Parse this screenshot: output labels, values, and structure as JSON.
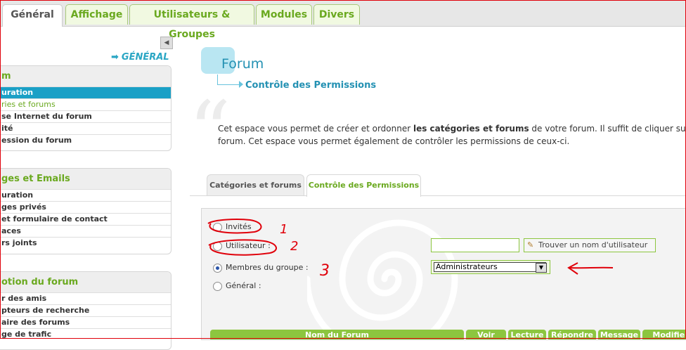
{
  "top_tabs": [
    "Général",
    "Affichage",
    "Utilisateurs & Groupes",
    "Modules",
    "Divers"
  ],
  "sidebar": {
    "section_heading": "GÉNÉRAL",
    "boxes": [
      {
        "title": "m",
        "items": [
          "uration",
          "ries et forums",
          "se Internet du forum",
          "ité",
          "ession du forum"
        ]
      },
      {
        "title": "ges et Emails",
        "items": [
          "uration",
          "ges privés",
          "et formulaire de contact",
          "aces",
          "rs joints"
        ]
      },
      {
        "title": "otion du forum",
        "items": [
          "r des amis",
          "pteurs de recherche",
          "aire des forums",
          "ge de trafic"
        ]
      }
    ]
  },
  "content": {
    "title": "Forum",
    "breadcrumb": "Contrôle des Permissions",
    "description_line1_pre": "Cet espace vous permet de créer et ordonner ",
    "description_line1_bold": "les catégories et forums",
    "description_line1_post": " de votre forum. Il suffit de cliquer sur les",
    "description_line2": "forum. Cet espace vous permet également de contrôler les permissions de ceux-ci."
  },
  "sub_tabs": [
    "Catégories et forums",
    "Contrôle des Permissions"
  ],
  "permissions": {
    "options": [
      "Invités",
      "Utilisateur :",
      "Membres du groupe :",
      "Général :"
    ],
    "selected_index": 2,
    "user_input_value": "",
    "find_user_button": "Trouver un nom d'utilisateur",
    "group_select_value": "Administrateurs"
  },
  "table_headers": [
    "Nom du Forum",
    "Voir",
    "Lecture",
    "Répondre",
    "Message",
    "Modifier"
  ],
  "annotations": [
    "1",
    "2",
    "3"
  ],
  "colors": {
    "accent_green": "#8cc63f",
    "accent_blue": "#1aa0c6",
    "annotation_red": "#e0000a"
  }
}
